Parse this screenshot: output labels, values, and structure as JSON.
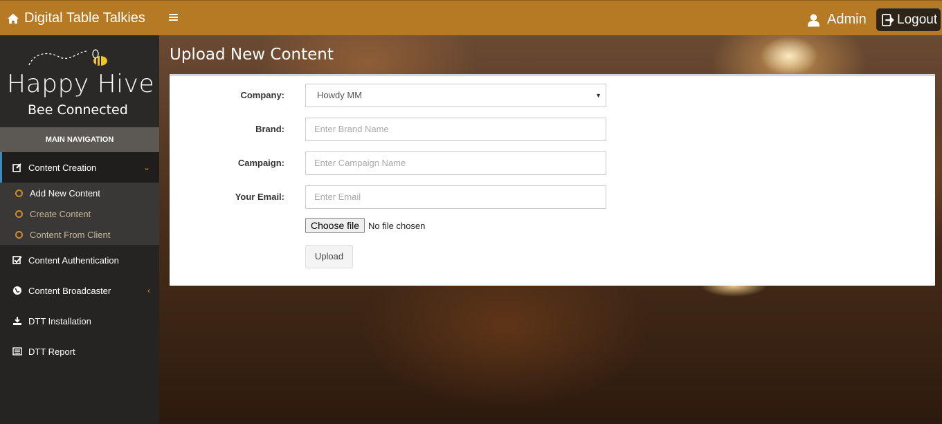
{
  "header": {
    "brand": "Digital Table Talkies",
    "user": "Admin",
    "logout_label": "Logout",
    "accent_color": "#b67a24"
  },
  "sidebar": {
    "logo_title": "Happy Hive",
    "logo_subtitle": "Bee Connected",
    "nav_header": "MAIN NAVIGATION",
    "items": [
      {
        "label": "Content Creation",
        "icon": "edit-icon",
        "expanded": true
      },
      {
        "label": "Content Authentication",
        "icon": "check-square-icon"
      },
      {
        "label": "Content Broadcaster",
        "icon": "globe-icon"
      },
      {
        "label": "DTT Installation",
        "icon": "download-icon"
      },
      {
        "label": "DTT Report",
        "icon": "list-icon"
      }
    ],
    "subitems": [
      {
        "label": "Add New Content",
        "active": true
      },
      {
        "label": "Create Content"
      },
      {
        "label": "Content From Client"
      }
    ]
  },
  "main": {
    "title": "Upload New Content",
    "form": {
      "company_label": "Company:",
      "company_value": "Howdy MM",
      "brand_label": "Brand:",
      "brand_placeholder": "Enter Brand Name",
      "campaign_label": "Campaign:",
      "campaign_placeholder": "Enter Campaign Name",
      "email_label": "Your Email:",
      "email_placeholder": "Enter Email",
      "choose_file_label": "Choose file",
      "no_file_text": "No file chosen",
      "upload_label": "Upload"
    }
  }
}
